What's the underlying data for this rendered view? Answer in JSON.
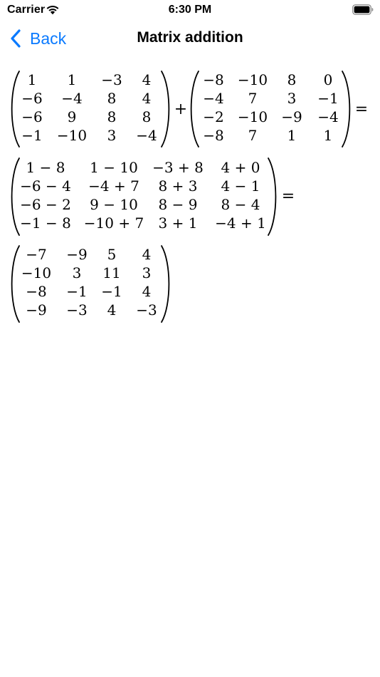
{
  "status_bar": {
    "carrier": "Carrier",
    "time": "6:30 PM",
    "wifi_icon": "wifi-icon",
    "battery_icon": "battery-icon"
  },
  "nav": {
    "back_label": "Back",
    "back_icon": "chevron-left-icon",
    "title": "Matrix addition",
    "accent_color": "#0A7AFF"
  },
  "equation": {
    "operator_plus": "+",
    "operator_equals": "=",
    "matrix_a": [
      [
        "1",
        "1",
        "−3",
        "4"
      ],
      [
        "−6",
        "−4",
        "8",
        "4"
      ],
      [
        "−6",
        "9",
        "8",
        "8"
      ],
      [
        "−1",
        "−10",
        "3",
        "−4"
      ]
    ],
    "matrix_b": [
      [
        "−8",
        "−10",
        "8",
        "0"
      ],
      [
        "−4",
        "7",
        "3",
        "−1"
      ],
      [
        "−2",
        "−10",
        "−9",
        "−4"
      ],
      [
        "−8",
        "7",
        "1",
        "1"
      ]
    ],
    "matrix_steps": [
      [
        "1 − 8",
        "1 − 10",
        "−3 + 8",
        "4 + 0"
      ],
      [
        "−6 − 4",
        "−4 + 7",
        "8 + 3",
        "4 − 1"
      ],
      [
        "−6 − 2",
        "9 − 10",
        "8 − 9",
        "8 − 4"
      ],
      [
        "−1 − 8",
        "−10 + 7",
        "3 + 1",
        "−4 + 1"
      ]
    ],
    "matrix_result": [
      [
        "−7",
        "−9",
        "5",
        "4"
      ],
      [
        "−10",
        "3",
        "11",
        "3"
      ],
      [
        "−8",
        "−1",
        "−1",
        "4"
      ],
      [
        "−9",
        "−3",
        "4",
        "−3"
      ]
    ]
  }
}
